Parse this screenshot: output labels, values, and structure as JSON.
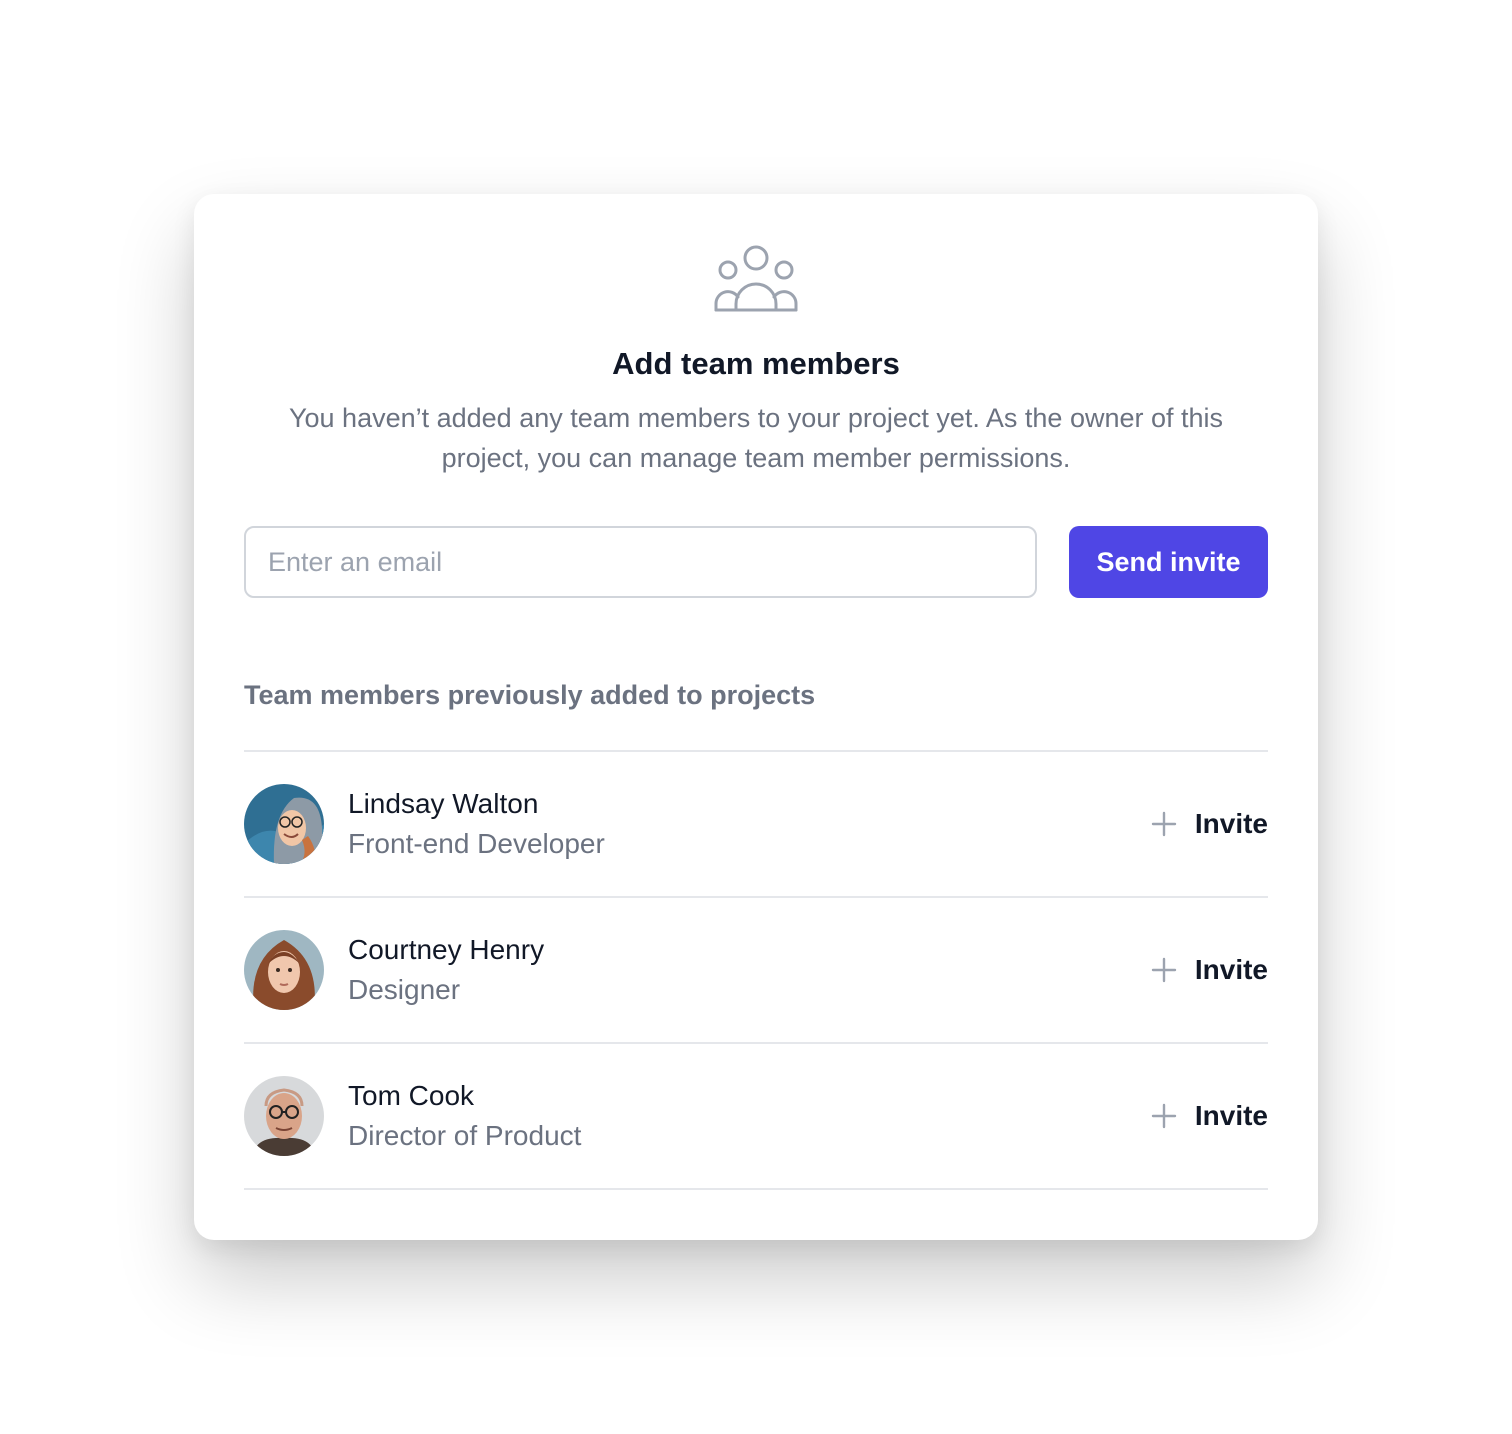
{
  "dialog": {
    "icon": "user-group-icon",
    "title": "Add team members",
    "subtitle": "You haven’t added any team members to your project yet. As the owner of this project, you can manage team member permissions."
  },
  "invite_form": {
    "email_value": "",
    "email_placeholder": "Enter an email",
    "send_label": "Send invite",
    "accent_color": "#4f46e5"
  },
  "members_section": {
    "heading": "Team members previously added to projects",
    "invite_icon": "plus-icon",
    "members": [
      {
        "name": "Lindsay Walton",
        "role": "Front-end Developer",
        "invite_label": "Invite",
        "avatar": "avatar-photo"
      },
      {
        "name": "Courtney Henry",
        "role": "Designer",
        "invite_label": "Invite",
        "avatar": "avatar-photo"
      },
      {
        "name": "Tom Cook",
        "role": "Director of Product",
        "invite_label": "Invite",
        "avatar": "avatar-photo"
      }
    ]
  }
}
